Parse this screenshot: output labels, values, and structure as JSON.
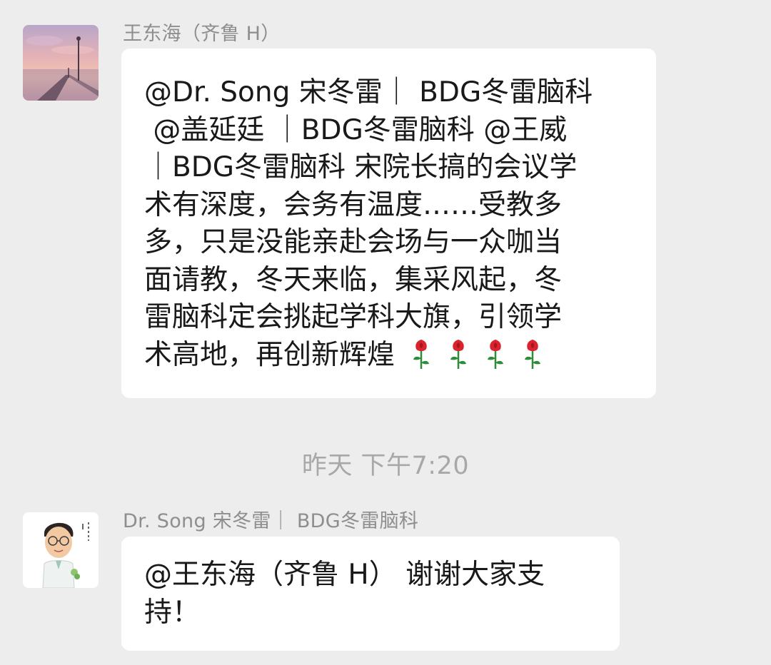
{
  "messages": [
    {
      "sender": "王东海（齐鲁 H）",
      "avatar_icon": "pier-sunset-avatar-icon",
      "lines": [
        "@Dr. Song 宋冬雷｜ BDG冬雷脑科",
        " @盖延廷 ｜BDG冬雷脑科 @王威",
        "｜BDG冬雷脑科 宋院长搞的会议学",
        "术有深度，会务有温度……受教多",
        "多，只是没能亲赴会场与一众咖当",
        "面请教，冬天来临，集采风起，冬",
        "雷脑科定会挑起学科大旗，引领学",
        "术高地，再创新辉煌"
      ],
      "emoji_icon": "rose-icon",
      "emoji_count_note": "4 roses"
    },
    {
      "sender": "Dr. Song 宋冬雷｜ BDG冬雷脑科",
      "avatar_icon": "doctor-cartoon-avatar-icon",
      "lines": [
        "@王东海（齐鲁 H） 谢谢大家支",
        "持！"
      ]
    }
  ],
  "timestamp": "昨天 下午7:20",
  "colors": {
    "background": "#ededed",
    "bubble": "#ffffff",
    "name": "#8e8e8e",
    "timestamp": "#a8a8a8",
    "rose_red": "#d9232e",
    "rose_stem": "#2e8b3a"
  }
}
